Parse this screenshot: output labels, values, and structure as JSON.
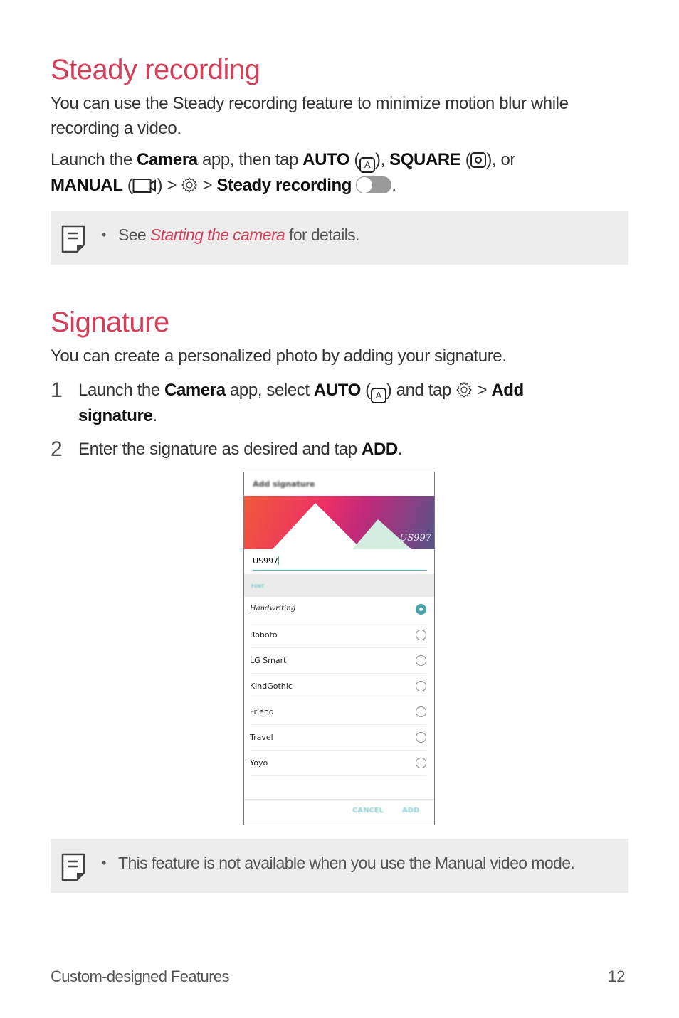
{
  "steady": {
    "title": "Steady recording",
    "intro_line1": "You can use the Steady recording feature to minimize motion blur while",
    "intro_line2": "recording a video.",
    "instr": {
      "launch": "Launch the ",
      "camera": "Camera",
      "then_tap": " app, then tap ",
      "auto": "AUTO",
      "open1": " (",
      "close1": "), ",
      "square": "SQUARE",
      "open2": " (",
      "close2": "), or",
      "manual": "MANUAL",
      "open3": " (",
      "close3": ") > ",
      "gt": " > ",
      "steady": "Steady recording",
      "period": "."
    },
    "auto_glyph": "A",
    "toggle_state": "off",
    "note": {
      "bullet": "•",
      "pre": "See ",
      "link": "Starting the camera",
      "post": " for details."
    }
  },
  "signature": {
    "title": "Signature",
    "intro": "You can create a personalized photo by adding your signature.",
    "steps": [
      {
        "num": "1",
        "launch": "Launch the ",
        "camera": "Camera",
        "select": " app, select ",
        "auto": "AUTO",
        "open": " (",
        "close": ") and tap ",
        "gt": " > ",
        "add": "Add",
        "signature": "signature",
        "period": "."
      },
      {
        "num": "2",
        "text": "Enter the signature as desired and tap ",
        "add": "ADD",
        "period": "."
      }
    ],
    "auto_glyph": "A",
    "phone": {
      "dialog_title": "Add signature",
      "preview_text": "US997",
      "input_value": "US997",
      "font_header": "FONT",
      "fonts": [
        {
          "label": "Handwriting",
          "selected": true
        },
        {
          "label": "Roboto",
          "selected": false
        },
        {
          "label": "LG Smart",
          "selected": false
        },
        {
          "label": "KindGothic",
          "selected": false
        },
        {
          "label": "Friend",
          "selected": false
        },
        {
          "label": "Travel",
          "selected": false
        },
        {
          "label": "Yoyo",
          "selected": false
        }
      ],
      "cancel": "CANCEL",
      "add": "ADD",
      "accent": "#4aa3ab"
    },
    "note": {
      "bullet": "•",
      "text": "This feature is not available when you use the Manual video mode."
    }
  },
  "footer": {
    "section": "Custom-designed Features",
    "page": "12"
  },
  "colors": {
    "heading": "#d4405c",
    "note_bg": "#ededed"
  }
}
